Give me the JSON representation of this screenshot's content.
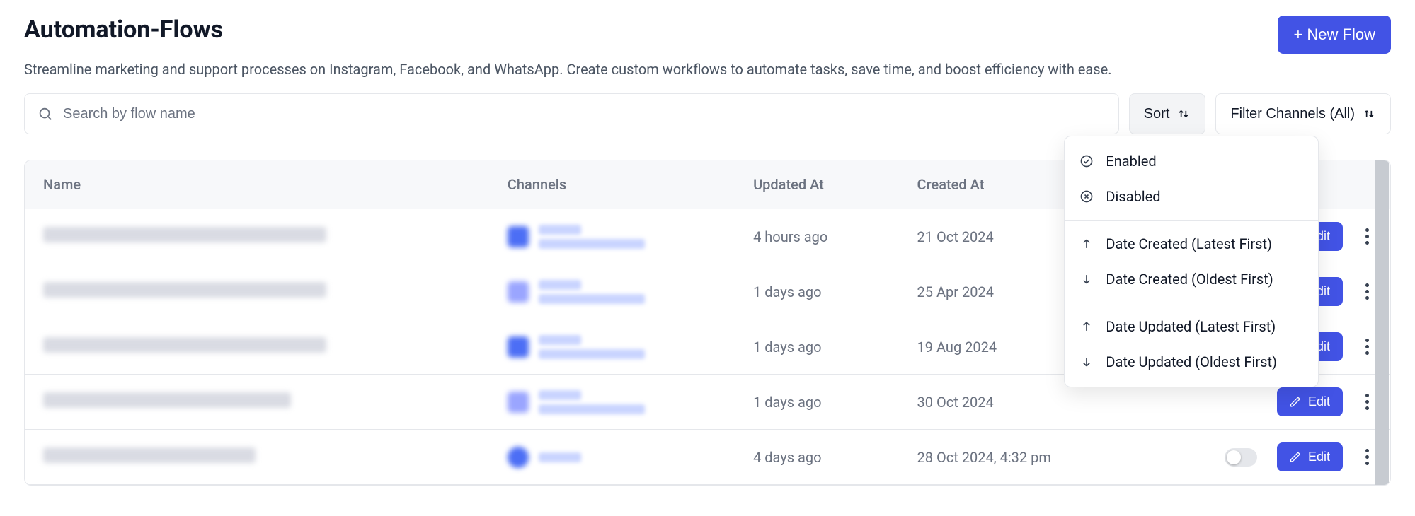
{
  "header": {
    "title": "Automation-Flows",
    "new_flow_label": "+ New Flow",
    "subtitle": "Streamline marketing and support processes on Instagram, Facebook, and WhatsApp. Create custom workflows to automate tasks, save time, and boost efficiency with ease."
  },
  "controls": {
    "search_placeholder": "Search by flow name",
    "sort_label": "Sort",
    "filter_label": "Filter Channels (All)"
  },
  "sort_dropdown": {
    "enabled": "Enabled",
    "disabled": "Disabled",
    "date_created_latest": "Date Created (Latest First)",
    "date_created_oldest": "Date Created (Oldest First)",
    "date_updated_latest": "Date Updated (Latest First)",
    "date_updated_oldest": "Date Updated (Oldest First)"
  },
  "table": {
    "headers": {
      "name": "Name",
      "channels": "Channels",
      "updated_at": "Updated At",
      "created_at": "Created At"
    },
    "rows": [
      {
        "updated_at": "4 hours ago",
        "created_at": "21 Oct 2024",
        "edit": "Edit"
      },
      {
        "updated_at": "1 days ago",
        "created_at": "25 Apr 2024",
        "edit": "Edit"
      },
      {
        "updated_at": "1 days ago",
        "created_at": "19 Aug 2024",
        "edit": "Edit"
      },
      {
        "updated_at": "1 days ago",
        "created_at": "30 Oct 2024",
        "edit": "Edit"
      },
      {
        "updated_at": "4 days ago",
        "created_at": "28 Oct 2024, 4:32 pm",
        "edit": "Edit"
      }
    ]
  },
  "colors": {
    "primary": "#4253e5"
  }
}
